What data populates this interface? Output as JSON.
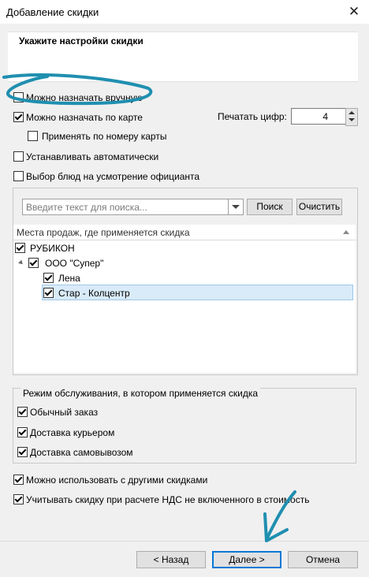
{
  "window": {
    "title": "Добавление скидки",
    "close_glyph": "✕"
  },
  "header": {
    "title": "Укажите настройки скидки"
  },
  "options": {
    "manual": {
      "label": "Можно назначать вручную",
      "checked": false
    },
    "by_card": {
      "label": "Можно назначать по карте",
      "checked": true
    },
    "by_card_number": {
      "label": "Применять по номеру карты",
      "checked": false
    },
    "auto": {
      "label": "Устанавливать автоматически",
      "checked": false
    },
    "waiter_choice": {
      "label": "Выбор блюд на усмотрение официанта",
      "checked": false
    }
  },
  "print_digits": {
    "label": "Печатать цифр:",
    "value": "4"
  },
  "search": {
    "placeholder": "Введите текст для поиска...",
    "search_button": "Поиск",
    "clear_button": "Очистить"
  },
  "places": {
    "header": "Места продаж, где применяется скидка",
    "nodes": [
      {
        "label": "РУБИКОН",
        "checked": true
      },
      {
        "label": "ООО \"Супер\"",
        "checked": true
      },
      {
        "label": "Лена",
        "checked": true
      },
      {
        "label": "Стар - Колцентр",
        "checked": true,
        "selected": true
      }
    ]
  },
  "service_mode": {
    "legend": "Режим обслуживания, в котором применяется скидка",
    "items": [
      {
        "label": "Обычный заказ",
        "checked": true
      },
      {
        "label": "Доставка курьером",
        "checked": true
      },
      {
        "label": "Доставка самовывозом",
        "checked": true
      }
    ]
  },
  "combine": {
    "label": "Можно использовать с другими скидками",
    "checked": true
  },
  "vat": {
    "label": "Учитывать скидку при расчете НДС не включенного в стоимость",
    "checked": true
  },
  "footer": {
    "back": "< Назад",
    "next": "Далее >",
    "cancel": "Отмена"
  },
  "colors": {
    "annotation": "#1f8fb0",
    "selection": "#d9ebf9",
    "accent": "#0078d7"
  }
}
